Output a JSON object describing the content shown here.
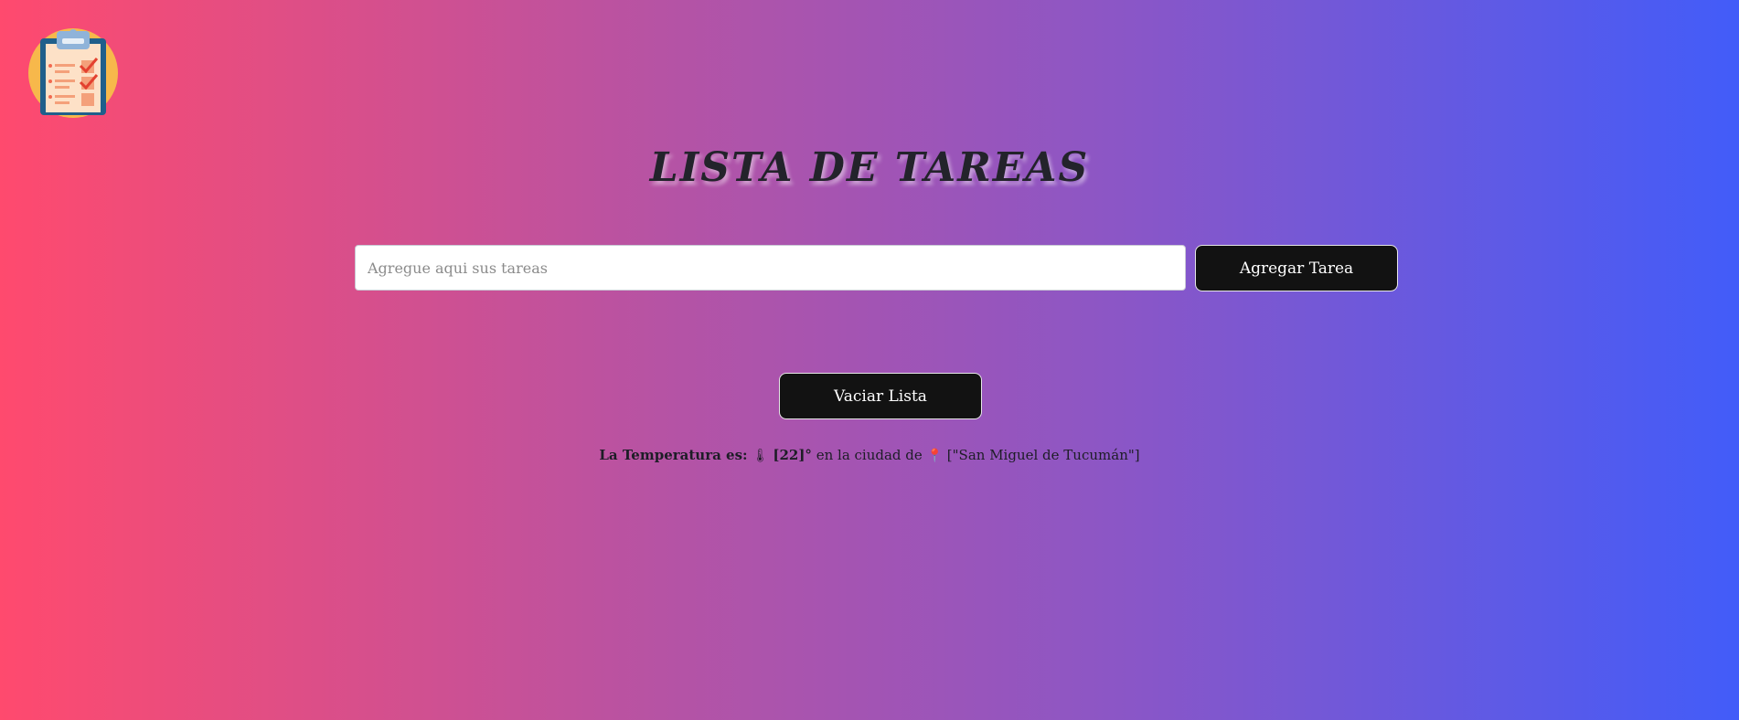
{
  "page": {
    "title": "LISTA DE TAREAS"
  },
  "task_input": {
    "placeholder": "Agregue aqui sus tareas",
    "value": ""
  },
  "buttons": {
    "add_label": "Agregar Tarea",
    "clear_label": "Vaciar Lista"
  },
  "weather": {
    "prefix": "La Temperatura es: ",
    "thermometer_glyph": "🌡",
    "temperature": "[22]°",
    "city_text": " en la ciudad de",
    "pin_glyph": "📍",
    "city": "[\"San Miguel de Tucumán\"]"
  },
  "icons": {
    "logo": "clipboard-checklist-icon",
    "thermometer": "thermometer-icon",
    "pin": "location-pin-icon"
  },
  "colors": {
    "gradient_start": "#ff4a6e",
    "gradient_end": "#425cf9",
    "button_bg": "#121212",
    "logo_circle": "#f7b84b",
    "logo_clipboard": "#1f5f8b"
  }
}
